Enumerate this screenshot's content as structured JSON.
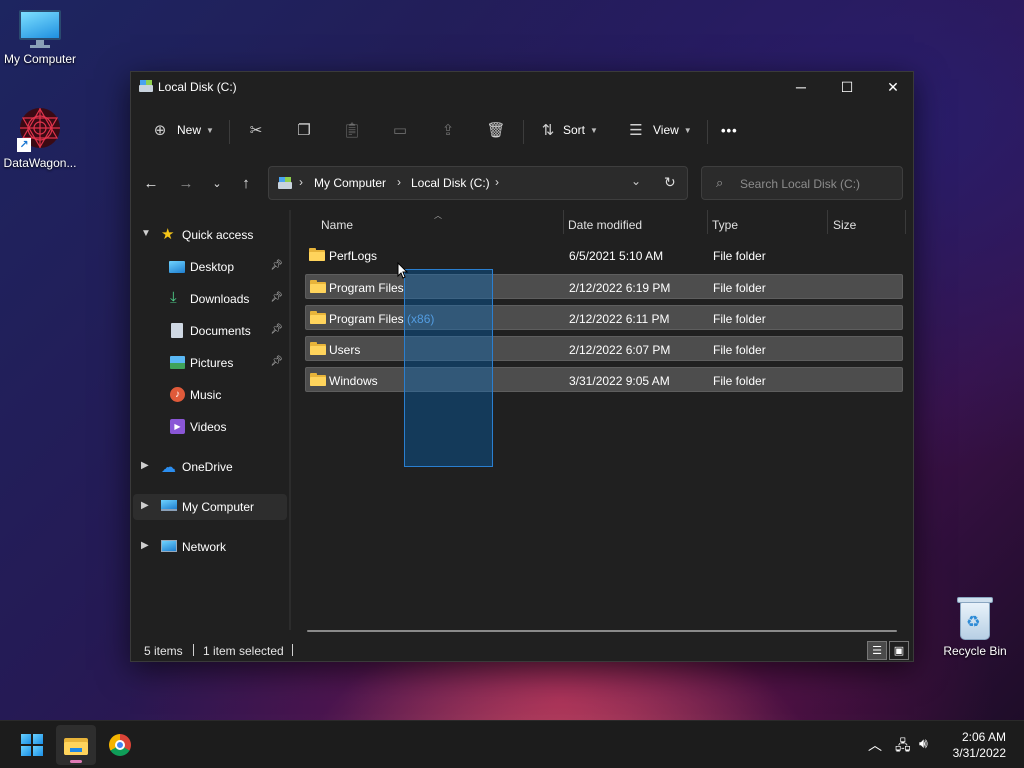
{
  "desktop": {
    "icons": [
      {
        "label": "My Computer"
      },
      {
        "label": "DataWagon..."
      },
      {
        "label": "Recycle Bin"
      }
    ]
  },
  "window": {
    "title": "Local Disk (C:)",
    "controls": {
      "minimize": "─",
      "maximize": "☐",
      "close": "✕"
    }
  },
  "toolbar": {
    "new_label": "New",
    "sort_label": "Sort",
    "view_label": "View",
    "more_label": "•••"
  },
  "address": {
    "crumbs": [
      "My Computer",
      "Local Disk (C:)"
    ],
    "separator": "›"
  },
  "search": {
    "placeholder": "Search Local Disk (C:)"
  },
  "sidebar": {
    "items": [
      {
        "label": "Quick access"
      },
      {
        "label": "Desktop"
      },
      {
        "label": "Downloads"
      },
      {
        "label": "Documents"
      },
      {
        "label": "Pictures"
      },
      {
        "label": "Music"
      },
      {
        "label": "Videos"
      },
      {
        "label": "OneDrive"
      },
      {
        "label": "My Computer"
      },
      {
        "label": "Network"
      }
    ]
  },
  "columns": {
    "name": "Name",
    "date": "Date modified",
    "type": "Type",
    "size": "Size"
  },
  "files": [
    {
      "name": "PerfLogs",
      "name_suffix": "",
      "date": "6/5/2021 5:10 AM",
      "type": "File folder",
      "selected": false
    },
    {
      "name": "Program Files",
      "name_suffix": "",
      "date": "2/12/2022 6:19 PM",
      "type": "File folder",
      "selected": true
    },
    {
      "name": "Program Files ",
      "name_suffix": "(x86)",
      "date": "2/12/2022 6:11 PM",
      "type": "File folder",
      "selected": true
    },
    {
      "name": "Users",
      "name_suffix": "",
      "date": "2/12/2022 6:07 PM",
      "type": "File folder",
      "selected": true
    },
    {
      "name": "Windows",
      "name_suffix": "",
      "date": "3/31/2022 9:05 AM",
      "type": "File folder",
      "selected": true
    }
  ],
  "status": {
    "items_count": "5 items",
    "selection": "1 item selected"
  },
  "taskbar": {
    "time": "2:06 AM",
    "date": "3/31/2022"
  },
  "colors": {
    "accent": "#0078d4",
    "folder": "#ffd45c",
    "window_bg": "#202020"
  }
}
